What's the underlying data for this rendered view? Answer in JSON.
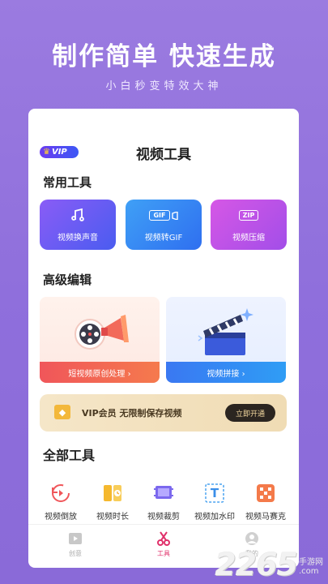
{
  "hero": {
    "title": "制作简单  快速生成",
    "subtitle": "小白秒变特效大神"
  },
  "header": {
    "vip_logo": "VIP",
    "title": "视频工具"
  },
  "common_tools": {
    "title": "常用工具",
    "items": [
      {
        "label": "视频换声音",
        "icon": "music-note-icon",
        "icon_text": "♫"
      },
      {
        "label": "视频转GIF",
        "icon": "gif-icon",
        "icon_text": "GIF"
      },
      {
        "label": "视频压缩",
        "icon": "zip-icon",
        "icon_text": "ZIP"
      }
    ]
  },
  "advanced": {
    "title": "高级编辑",
    "items": [
      {
        "label": "短视频原创处理  ›",
        "icon": "film-reel-megaphone-icon"
      },
      {
        "label": "视频拼接  ›",
        "icon": "clapperboard-icon"
      }
    ]
  },
  "vip_banner": {
    "text": "VIP会员  无限制保存视频",
    "button": "立即开通",
    "icon": "diamond-icon"
  },
  "all_tools": {
    "title": "全部工具",
    "items": [
      {
        "label": "视频倒放",
        "icon": "rewind-icon"
      },
      {
        "label": "视频时长",
        "icon": "duration-icon"
      },
      {
        "label": "视频裁剪",
        "icon": "crop-icon"
      },
      {
        "label": "视频加水印",
        "icon": "watermark-icon",
        "icon_text": "T"
      },
      {
        "label": "视频马赛克",
        "icon": "mosaic-icon"
      }
    ]
  },
  "tabbar": {
    "items": [
      {
        "label": "创意",
        "icon": "play-icon",
        "active": false
      },
      {
        "label": "工具",
        "icon": "scissors-icon",
        "active": true
      },
      {
        "label": "我的",
        "icon": "profile-icon",
        "active": false
      }
    ]
  },
  "watermark": {
    "number": "2265",
    "site_cn": "手游网",
    "site_en": ".com"
  },
  "colors": {
    "background": "#9b7be0",
    "accent_pink": "#e0306a",
    "vip_gold": "#f3b83a"
  }
}
